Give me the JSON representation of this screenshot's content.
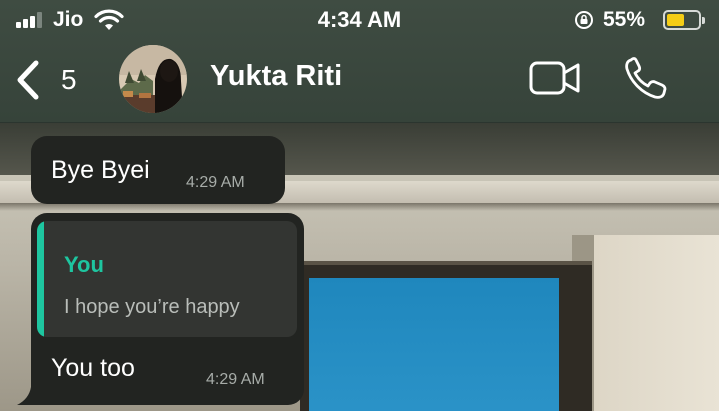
{
  "status_bar": {
    "carrier": "Jio",
    "time": "4:34 AM",
    "battery_percent": "55%",
    "battery_level": 0.55,
    "signal_bars_active": 3,
    "signal_bars_total": 4
  },
  "nav": {
    "back_icon": "chevron-left",
    "unread_count": "5",
    "contact_name": "Yukta Riti",
    "video_call_icon": "video-camera",
    "voice_call_icon": "phone"
  },
  "messages": [
    {
      "text": "Bye Byei",
      "time": "4:29 AM"
    },
    {
      "quote": {
        "author": "You",
        "text": "I hope you’re happy"
      },
      "text": "You too",
      "time": "4:29 AM"
    }
  ],
  "colors": {
    "accent": "#1ec6a0",
    "header_bg": "#3c493f",
    "bubble_bg": "#222421",
    "battery": "#f5cd15"
  }
}
